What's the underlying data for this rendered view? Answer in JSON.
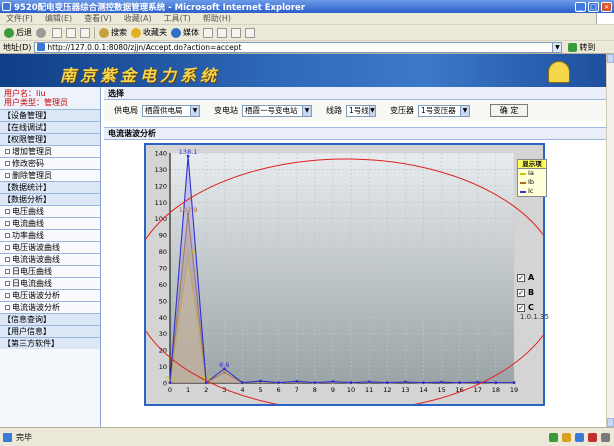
{
  "window": {
    "title": "9520配电变压器综合测控数据管理系统 - Microsoft Internet Explorer"
  },
  "menu": [
    "文件(F)",
    "编辑(E)",
    "查看(V)",
    "收藏(A)",
    "工具(T)",
    "帮助(H)"
  ],
  "toolbar": {
    "back": "后退",
    "search": "搜索",
    "favorites": "收藏夹",
    "media": "媒体"
  },
  "address": {
    "label": "地址(D)",
    "url": "http://127.0.0.1:8080/zjjn/Accept.do?action=accept",
    "go": "转到"
  },
  "banner": {
    "brand": "南京紫金电力系统"
  },
  "user": {
    "name_label": "用户名：",
    "name": "liu",
    "type_label": "用户类型：",
    "type": "管理员"
  },
  "nav": [
    {
      "label": "【设备管理】",
      "sub": false
    },
    {
      "label": "【在线调试】",
      "sub": false
    },
    {
      "label": "【权限管理】",
      "sub": false
    },
    {
      "label": "增加管理员",
      "sub": true
    },
    {
      "label": "修改密码",
      "sub": true
    },
    {
      "label": "删除管理员",
      "sub": true
    },
    {
      "label": "【数据统计】",
      "sub": false
    },
    {
      "label": "【数据分析】",
      "sub": false
    },
    {
      "label": "电压曲线",
      "sub": true
    },
    {
      "label": "电流曲线",
      "sub": true
    },
    {
      "label": "功率曲线",
      "sub": true
    },
    {
      "label": "电压谐波曲线",
      "sub": true
    },
    {
      "label": "电流谐波曲线",
      "sub": true
    },
    {
      "label": "日电压曲线",
      "sub": true
    },
    {
      "label": "日电流曲线",
      "sub": true
    },
    {
      "label": "电压谐波分析",
      "sub": true
    },
    {
      "label": "电流谐波分析",
      "sub": true
    },
    {
      "label": "【信息查询】",
      "sub": false
    },
    {
      "label": "【用户信息】",
      "sub": false
    },
    {
      "label": "【第三方软件】",
      "sub": false
    }
  ],
  "select_section": {
    "title": "选择",
    "supply_label": "供电局",
    "supply_value": "栖霞供电局",
    "station_label": "变电站",
    "station_value": "栖霞一号变电站",
    "line_label": "线路",
    "line_value": "1号线",
    "transformer_label": "变压器",
    "transformer_value": "1号变压器",
    "confirm": "确  定"
  },
  "analysis_title": "电流谐波分析",
  "legend": {
    "title": "显示项",
    "items": [
      "Ia",
      "Ib",
      "Ic"
    ]
  },
  "checkboxes": [
    "A",
    "B",
    "C"
  ],
  "version": "1.0.1.35",
  "statusbar": {
    "text": "完毕"
  },
  "colors": {
    "ia": "#c8c800",
    "ib": "#b5651d",
    "ic": "#3030d0",
    "banner": "#1e4f9e",
    "ellipse": "#e02020"
  },
  "chart_data": {
    "type": "line",
    "x": [
      0,
      1,
      2,
      3,
      4,
      5,
      6,
      7,
      8,
      9,
      10,
      11,
      12,
      13,
      14,
      15,
      16,
      17,
      18,
      19
    ],
    "xlim": [
      0,
      19
    ],
    "ylim": [
      0,
      140
    ],
    "yticks": [
      0,
      10,
      20,
      30,
      40,
      50,
      60,
      70,
      80,
      90,
      100,
      110,
      120,
      130,
      140
    ],
    "grid": true,
    "legend_position": "top-right",
    "series": [
      {
        "name": "Ia",
        "values": [
          0.2,
          77.4,
          0.2,
          8.6,
          0.2,
          0.9,
          0.2,
          0.7,
          0.2,
          0.6,
          0.2,
          0.5,
          0.2,
          0.4,
          0.2,
          0.4,
          0.2,
          0.3,
          0.2,
          0.2
        ]
      },
      {
        "name": "Ib",
        "values": [
          0.2,
          102.9,
          0.2,
          6.5,
          0.2,
          1.0,
          0.2,
          0.8,
          0.2,
          0.7,
          0.2,
          0.6,
          0.2,
          0.5,
          0.2,
          0.5,
          0.2,
          0.4,
          0.2,
          0.2
        ]
      },
      {
        "name": "Ic",
        "values": [
          0.2,
          138.1,
          0.2,
          8.6,
          0.2,
          1.2,
          0.2,
          1.0,
          0.2,
          0.9,
          0.2,
          0.7,
          0.2,
          0.6,
          0.2,
          0.5,
          0.2,
          0.5,
          0.2,
          0.2
        ]
      }
    ],
    "data_labels": [
      {
        "x": 1,
        "y": 138.1,
        "text": "138.1",
        "series": "Ic"
      },
      {
        "x": 1,
        "y": 102.9,
        "text": "102.9",
        "series": "Ib"
      },
      {
        "x": 1,
        "y": 77.4,
        "text": "77.4",
        "series": "Ia"
      },
      {
        "x": 3,
        "y": 8.6,
        "text": "8.6",
        "series": "Ic"
      },
      {
        "x": 0,
        "y": 0.2,
        "text": "0.2",
        "series": "Ia"
      },
      {
        "x": 2,
        "y": 0.2,
        "text": "0.2",
        "series": "Ia"
      }
    ]
  }
}
